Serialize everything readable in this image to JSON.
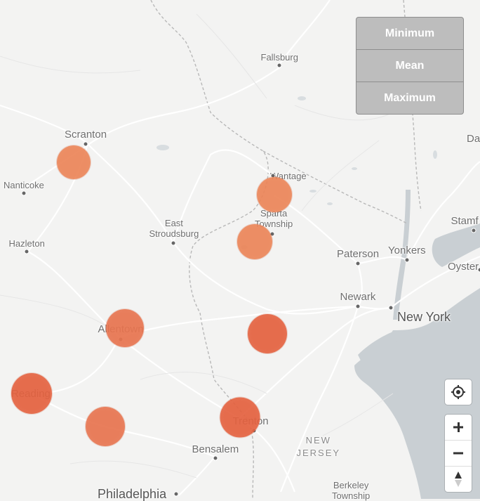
{
  "map": {
    "places": [
      {
        "name": "Fallsburg",
        "style": "small"
      },
      {
        "name": "Scranton",
        "style": "mid"
      },
      {
        "name": "Nanticoke",
        "style": "small"
      },
      {
        "name": "Wantage",
        "style": "small"
      },
      {
        "name": "Sparta Township",
        "style": "small"
      },
      {
        "name": "East Stroudsburg",
        "style": "small"
      },
      {
        "name": "Hazleton",
        "style": "small"
      },
      {
        "name": "Paterson",
        "style": "mid"
      },
      {
        "name": "Yonkers",
        "style": "mid"
      },
      {
        "name": "Stamf",
        "style": "mid"
      },
      {
        "name": "Oyster",
        "style": "mid"
      },
      {
        "name": "Da",
        "style": "mid"
      },
      {
        "name": "Newark",
        "style": "mid"
      },
      {
        "name": "New York",
        "style": "city"
      },
      {
        "name": "Allentown",
        "style": "mid"
      },
      {
        "name": "Reading",
        "style": "mid"
      },
      {
        "name": "Trenton",
        "style": "mid"
      },
      {
        "name": "Bensalem",
        "style": "mid"
      },
      {
        "name": "NEW JERSEY",
        "style": "state"
      },
      {
        "name": "Berkeley Township",
        "style": "small"
      },
      {
        "name": "Philadelphia",
        "style": "city"
      }
    ],
    "marker_color": "#e8744f",
    "marker_colors": [
      "#ec8558",
      "#e8744f",
      "#e4613f"
    ]
  },
  "stat_buttons": {
    "minimum": "Minimum",
    "mean": "Mean",
    "maximum": "Maximum"
  },
  "controls": {
    "locate_icon": "crosshair-icon",
    "zoom_in_icon": "plus-icon",
    "zoom_out_icon": "minus-icon",
    "compass_icon": "compass-icon",
    "zoom_in": "+",
    "zoom_out": "−"
  }
}
